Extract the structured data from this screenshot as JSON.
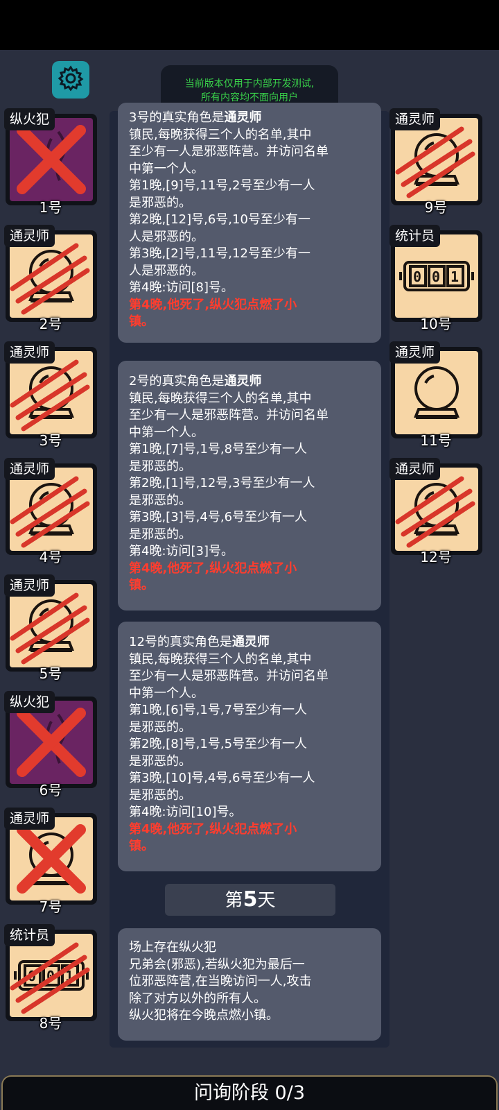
{
  "notice": {
    "line1": "当前版本仅用于内部开发测试,",
    "line2": "所有内容均不面向用户"
  },
  "icons": {
    "settings": "gear-icon"
  },
  "colors": {
    "accent_teal": "#1f9aa6",
    "notice_green": "#39d24a",
    "death_red": "#ff3d2e",
    "town_bg": "#f7d6a6",
    "evil_bg": "#6a2462"
  },
  "players_left": [
    {
      "role": "纵火犯",
      "number": "1号",
      "team": "evil",
      "mark": "x"
    },
    {
      "role": "通灵师",
      "number": "2号",
      "team": "town",
      "mark": "claw"
    },
    {
      "role": "通灵师",
      "number": "3号",
      "team": "town",
      "mark": "claw"
    },
    {
      "role": "通灵师",
      "number": "4号",
      "team": "town",
      "mark": "claw"
    },
    {
      "role": "通灵师",
      "number": "5号",
      "team": "town",
      "mark": "claw"
    },
    {
      "role": "纵火犯",
      "number": "6号",
      "team": "evil",
      "mark": "x"
    },
    {
      "role": "通灵师",
      "number": "7号",
      "team": "town",
      "mark": "x"
    },
    {
      "role": "统计员",
      "number": "8号",
      "team": "town",
      "mark": "claw"
    }
  ],
  "players_right": [
    {
      "role": "通灵师",
      "number": "9号",
      "team": "town",
      "mark": "claw"
    },
    {
      "role": "统计员",
      "number": "10号",
      "team": "town",
      "mark": "none"
    },
    {
      "role": "通灵师",
      "number": "11号",
      "team": "town",
      "mark": "none"
    },
    {
      "role": "通灵师",
      "number": "12号",
      "team": "town",
      "mark": "claw"
    }
  ],
  "logs": [
    {
      "title_prefix": "3号的真实角色是",
      "title_role": "通灵师",
      "lines": [
        "镇民,每晚获得三个人的名单,其中",
        "至少有一人是邪恶阵营。并访问名单",
        "中第一个人。",
        "第1晚,[9]号,11号,2号至少有一人",
        "是邪恶的。",
        "第2晚,[12]号,6号,10号至少有一",
        "人是邪恶的。",
        "第3晚,[2]号,11号,12号至少有一",
        "人是邪恶的。",
        "第4晚:访问[8]号。"
      ],
      "death_lines": [
        "第4晚,他死了,纵火犯点燃了小",
        "镇。"
      ]
    },
    {
      "title_prefix": "2号的真实角色是",
      "title_role": "通灵师",
      "lines": [
        "镇民,每晚获得三个人的名单,其中",
        "至少有一人是邪恶阵营。并访问名单",
        "中第一个人。",
        "第1晚,[7]号,1号,8号至少有一人",
        "是邪恶的。",
        "第2晚,[1]号,12号,3号至少有一人",
        "是邪恶的。",
        "第3晚,[3]号,4号,6号至少有一人",
        "是邪恶的。",
        "第4晚:访问[3]号。"
      ],
      "death_lines": [
        "第4晚,他死了,纵火犯点燃了小",
        "镇。"
      ]
    },
    {
      "title_prefix": "12号的真实角色是",
      "title_role": "通灵师",
      "lines": [
        "镇民,每晚获得三个人的名单,其中",
        "至少有一人是邪恶阵营。并访问名单",
        "中第一个人。",
        "第1晚,[6]号,1号,7号至少有一人",
        "是邪恶的。",
        "第2晚,[8]号,1号,5号至少有一人",
        "是邪恶的。",
        "第3晚,[10]号,4号,6号至少有一人",
        "是邪恶的。",
        "第4晚:访问[10]号。"
      ],
      "death_lines": [
        "第4晚,他死了,纵火犯点燃了小",
        "镇。"
      ]
    }
  ],
  "day_banner": {
    "prefix": "第",
    "number": "5",
    "suffix": "天"
  },
  "arsonist_info": {
    "lines": [
      "场上存在纵火犯",
      "兄弟会(邪恶),若纵火犯为最后一",
      "位邪恶阵营,在当晚访问一人,攻击",
      "除了对方以外的所有人。",
      "纵火犯将在今晚点燃小镇。"
    ]
  },
  "bottom_bar": {
    "label": "问询阶段 0/3"
  }
}
